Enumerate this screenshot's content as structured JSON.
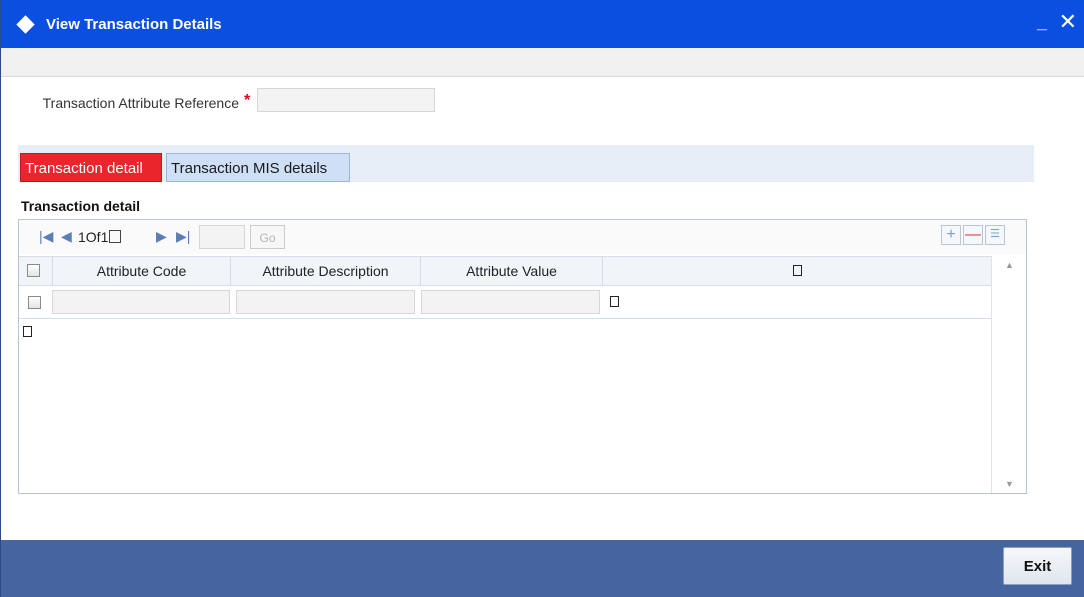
{
  "window": {
    "title": "View Transaction Details",
    "minimize_glyph": "_",
    "close_glyph": "✕",
    "icon": "diamond-icon"
  },
  "form": {
    "reference_label": "Transaction Attribute Reference",
    "required_mark": "*",
    "reference_value": ""
  },
  "tabs": [
    {
      "label": "Transaction detail",
      "active": true
    },
    {
      "label": "Transaction MIS details",
      "active": false
    }
  ],
  "section": {
    "title": "Transaction detail"
  },
  "pager": {
    "current": "1",
    "of_text": "Of",
    "total": "1",
    "page_input": "",
    "go_label": "Go",
    "first_glyph": "|◀",
    "prev_glyph": "◀",
    "next_glyph": "▶",
    "last_glyph": "▶|",
    "add_glyph": "+",
    "delete_glyph": "—",
    "list_glyph": "☰"
  },
  "grid": {
    "columns": [
      "Attribute Code",
      "Attribute Description",
      "Attribute Value",
      ""
    ],
    "rows": [
      {
        "attribute_code": "",
        "attribute_description": "",
        "attribute_value": "",
        "extra": ""
      }
    ]
  },
  "footer": {
    "exit_label": "Exit"
  },
  "colors": {
    "titlebar": "#0a4fe0",
    "active_tab": "#e8262b",
    "footer": "#4664a0"
  }
}
